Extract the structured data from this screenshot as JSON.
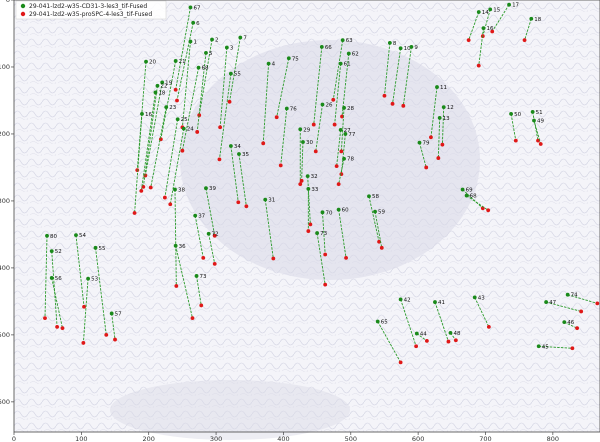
{
  "colors": {
    "start": "#1a8a1a",
    "end": "#e01818",
    "line": "#2a9a2a",
    "background": "#f3f3f8",
    "tissue": "#c8c8dc"
  },
  "chart_data": {
    "type": "scatter",
    "xlim": [
      0,
      870
    ],
    "ylim": [
      0,
      645
    ],
    "y_inverted": true,
    "x_ticks": [
      0,
      100,
      200,
      300,
      400,
      500,
      600,
      700,
      800
    ],
    "y_ticks": [
      0,
      100,
      200,
      300,
      400,
      500,
      600
    ],
    "grid": false,
    "legend_position": "top-left",
    "series": [
      {
        "name": "29-041-lzd2-w35-CD31-3-les3_tif-Fused",
        "marker": "circle",
        "color": "#1a8a1a"
      },
      {
        "name": "29-041-lzd2-w35-proSPC-4-les3_tif-Fused",
        "marker": "circle",
        "color": "#e01818"
      }
    ],
    "pairs": [
      {
        "label": "67",
        "start": [
          262,
          11
        ],
        "end": [
          240,
          134
        ]
      },
      {
        "label": "6",
        "start": [
          266,
          34
        ],
        "end": [
          242,
          150
        ]
      },
      {
        "label": "2",
        "start": [
          294,
          59
        ],
        "end": [
          275,
          172
        ]
      },
      {
        "label": "7",
        "start": [
          336,
          56
        ],
        "end": [
          320,
          152
        ]
      },
      {
        "label": "1",
        "start": [
          262,
          62
        ],
        "end": [
          250,
          190
        ]
      },
      {
        "label": "3",
        "start": [
          316,
          71
        ],
        "end": [
          306,
          190
        ]
      },
      {
        "label": "5",
        "start": [
          285,
          79
        ],
        "end": [
          272,
          197
        ]
      },
      {
        "label": "21",
        "start": [
          240,
          91
        ],
        "end": [
          218,
          208
        ]
      },
      {
        "label": "68",
        "start": [
          274,
          101
        ],
        "end": [
          250,
          225
        ]
      },
      {
        "label": "4",
        "start": [
          378,
          95
        ],
        "end": [
          370,
          214
        ]
      },
      {
        "label": "75",
        "start": [
          408,
          87
        ],
        "end": [
          390,
          175
        ]
      },
      {
        "label": "20",
        "start": [
          196,
          92
        ],
        "end": [
          183,
          254
        ]
      },
      {
        "label": "19",
        "start": [
          220,
          123
        ],
        "end": [
          195,
          262
        ]
      },
      {
        "label": "22",
        "start": [
          213,
          128
        ],
        "end": [
          192,
          279
        ]
      },
      {
        "label": "18",
        "start": [
          210,
          138
        ],
        "end": [
          189,
          285
        ]
      },
      {
        "label": "23",
        "start": [
          226,
          160
        ],
        "end": [
          203,
          280
        ]
      },
      {
        "label": "25",
        "start": [
          243,
          178
        ],
        "end": [
          224,
          295
        ]
      },
      {
        "label": "24",
        "start": [
          252,
          192
        ],
        "end": [
          232,
          305
        ]
      },
      {
        "label": "16",
        "start": [
          190,
          170
        ],
        "end": [
          179,
          318
        ]
      },
      {
        "label": "55",
        "start": [
          322,
          110
        ],
        "end": [
          305,
          238
        ]
      },
      {
        "label": "66",
        "start": [
          457,
          70
        ],
        "end": [
          445,
          186
        ]
      },
      {
        "label": "63",
        "start": [
          488,
          60
        ],
        "end": [
          474,
          149
        ]
      },
      {
        "label": "62",
        "start": [
          497,
          80
        ],
        "end": [
          487,
          174
        ]
      },
      {
        "label": "61",
        "start": [
          485,
          95
        ],
        "end": [
          476,
          186
        ]
      },
      {
        "label": "8",
        "start": [
          558,
          64
        ],
        "end": [
          550,
          143
        ]
      },
      {
        "label": "10",
        "start": [
          574,
          72
        ],
        "end": [
          562,
          155
        ]
      },
      {
        "label": "9",
        "start": [
          590,
          70
        ],
        "end": [
          578,
          158
        ]
      },
      {
        "label": "14",
        "start": [
          690,
          18
        ],
        "end": [
          675,
          60
        ]
      },
      {
        "label": "17",
        "start": [
          735,
          7
        ],
        "end": [
          710,
          47
        ]
      },
      {
        "label": "15",
        "start": [
          707,
          14
        ],
        "end": [
          696,
          54
        ]
      },
      {
        "label": "16",
        "start": [
          697,
          42
        ],
        "end": [
          690,
          98
        ]
      },
      {
        "label": "18",
        "start": [
          768,
          28
        ],
        "end": [
          758,
          60
        ]
      },
      {
        "label": "11",
        "start": [
          628,
          130
        ],
        "end": [
          619,
          205
        ]
      },
      {
        "label": "12",
        "start": [
          638,
          160
        ],
        "end": [
          636,
          216
        ]
      },
      {
        "label": "13",
        "start": [
          632,
          176
        ],
        "end": [
          630,
          236
        ]
      },
      {
        "label": "79",
        "start": [
          602,
          213
        ],
        "end": [
          612,
          250
        ]
      },
      {
        "label": "50",
        "start": [
          738,
          170
        ],
        "end": [
          745,
          210
        ]
      },
      {
        "label": "51",
        "start": [
          770,
          167
        ],
        "end": [
          778,
          210
        ]
      },
      {
        "label": "49",
        "start": [
          772,
          180
        ],
        "end": [
          782,
          215
        ]
      },
      {
        "label": "76",
        "start": [
          405,
          162
        ],
        "end": [
          396,
          247
        ]
      },
      {
        "label": "26",
        "start": [
          458,
          156
        ],
        "end": [
          448,
          226
        ]
      },
      {
        "label": "28",
        "start": [
          490,
          161
        ],
        "end": [
          486,
          226
        ]
      },
      {
        "label": "27",
        "start": [
          485,
          194
        ],
        "end": [
          479,
          248
        ]
      },
      {
        "label": "77",
        "start": [
          492,
          200
        ],
        "end": [
          486,
          260
        ]
      },
      {
        "label": "29",
        "start": [
          425,
          193
        ],
        "end": [
          425,
          275
        ]
      },
      {
        "label": "30",
        "start": [
          429,
          212
        ],
        "end": [
          427,
          270
        ]
      },
      {
        "label": "78",
        "start": [
          490,
          237
        ],
        "end": [
          482,
          275
        ]
      },
      {
        "label": "34",
        "start": [
          322,
          218
        ],
        "end": [
          333,
          302
        ]
      },
      {
        "label": "35",
        "start": [
          334,
          230
        ],
        "end": [
          345,
          308
        ]
      },
      {
        "label": "32",
        "start": [
          436,
          263
        ],
        "end": [
          440,
          335
        ]
      },
      {
        "label": "33",
        "start": [
          437,
          282
        ],
        "end": [
          437,
          345
        ]
      },
      {
        "label": "31",
        "start": [
          373,
          298
        ],
        "end": [
          385,
          386
        ]
      },
      {
        "label": "70",
        "start": [
          458,
          317
        ],
        "end": [
          462,
          380
        ]
      },
      {
        "label": "60",
        "start": [
          482,
          313
        ],
        "end": [
          493,
          385
        ]
      },
      {
        "label": "73",
        "start": [
          450,
          348
        ],
        "end": [
          462,
          425
        ]
      },
      {
        "label": "58",
        "start": [
          527,
          293
        ],
        "end": [
          542,
          361
        ]
      },
      {
        "label": "59",
        "start": [
          536,
          316
        ],
        "end": [
          546,
          370
        ]
      },
      {
        "label": "69",
        "start": [
          666,
          283
        ],
        "end": [
          696,
          311
        ]
      },
      {
        "label": "68",
        "start": [
          672,
          292
        ],
        "end": [
          704,
          314
        ]
      },
      {
        "label": "38",
        "start": [
          239,
          283
        ],
        "end": [
          241,
          427
        ]
      },
      {
        "label": "39",
        "start": [
          285,
          281
        ],
        "end": [
          298,
          352
        ]
      },
      {
        "label": "37",
        "start": [
          269,
          322
        ],
        "end": [
          281,
          385
        ]
      },
      {
        "label": "72",
        "start": [
          289,
          349
        ],
        "end": [
          298,
          394
        ]
      },
      {
        "label": "36",
        "start": [
          240,
          367
        ],
        "end": [
          265,
          475
        ]
      },
      {
        "label": "73",
        "start": [
          271,
          412
        ],
        "end": [
          278,
          456
        ]
      },
      {
        "label": "80",
        "start": [
          49,
          352
        ],
        "end": [
          46,
          475
        ]
      },
      {
        "label": "52",
        "start": [
          56,
          375
        ],
        "end": [
          64,
          488
        ]
      },
      {
        "label": "56",
        "start": [
          56,
          415
        ],
        "end": [
          72,
          490
        ]
      },
      {
        "label": "54",
        "start": [
          92,
          351
        ],
        "end": [
          104,
          458
        ]
      },
      {
        "label": "53",
        "start": [
          110,
          416
        ],
        "end": [
          103,
          512
        ]
      },
      {
        "label": "55",
        "start": [
          121,
          370
        ],
        "end": [
          137,
          500
        ]
      },
      {
        "label": "57",
        "start": [
          145,
          468
        ],
        "end": [
          150,
          507
        ]
      },
      {
        "label": "42",
        "start": [
          574,
          447
        ],
        "end": [
          597,
          517
        ]
      },
      {
        "label": "41",
        "start": [
          625,
          451
        ],
        "end": [
          645,
          510
        ]
      },
      {
        "label": "43",
        "start": [
          684,
          444
        ],
        "end": [
          705,
          488
        ]
      },
      {
        "label": "44",
        "start": [
          598,
          498
        ],
        "end": [
          613,
          509
        ]
      },
      {
        "label": "48",
        "start": [
          648,
          497
        ],
        "end": [
          656,
          508
        ]
      },
      {
        "label": "65",
        "start": [
          540,
          480
        ],
        "end": [
          574,
          541
        ]
      },
      {
        "label": "47",
        "start": [
          790,
          451
        ],
        "end": [
          842,
          465
        ]
      },
      {
        "label": "74",
        "start": [
          822,
          440
        ],
        "end": [
          866,
          453
        ]
      },
      {
        "label": "46",
        "start": [
          817,
          481
        ],
        "end": [
          836,
          490
        ]
      },
      {
        "label": "45",
        "start": [
          779,
          517
        ],
        "end": [
          829,
          520
        ]
      }
    ]
  }
}
